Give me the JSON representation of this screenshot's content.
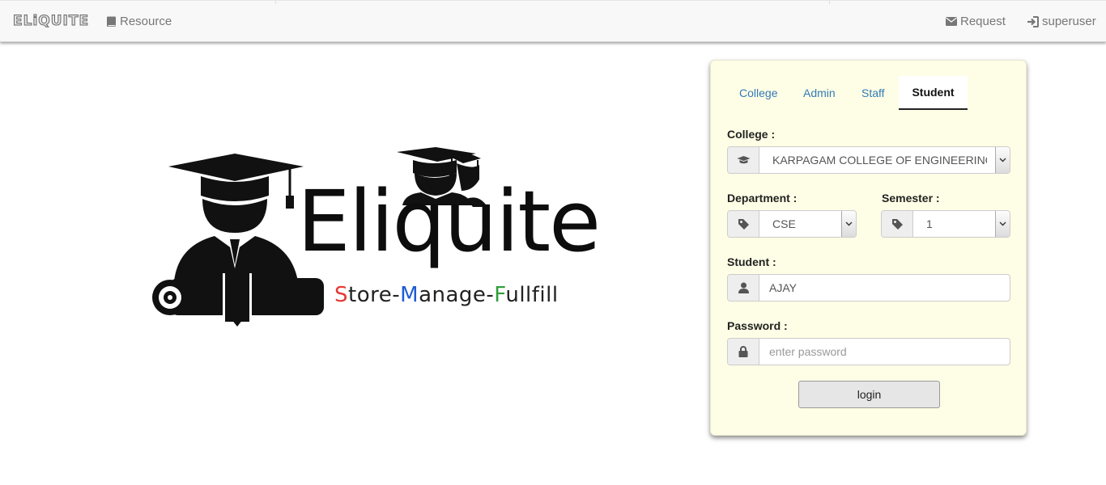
{
  "navbar": {
    "brand": "ELiQUITE",
    "resource_label": "Resource",
    "request_label": "Request",
    "user_label": "superuser"
  },
  "logo": {
    "word": "Eliquite",
    "tagline": {
      "s": "S",
      "tore": "tore-",
      "m": "M",
      "anage": "anage-",
      "f": "F",
      "ullfill": "ullfill"
    }
  },
  "login": {
    "tabs": [
      "College",
      "Admin",
      "Staff",
      "Student"
    ],
    "active_tab": "Student",
    "college_label": "College :",
    "college_value": "KARPAGAM COLLEGE OF ENGINEERING",
    "department_label": "Department :",
    "department_value": "CSE",
    "semester_label": "Semester :",
    "semester_value": "1",
    "student_label": "Student :",
    "student_value": "AJAY",
    "password_label": "Password :",
    "password_placeholder": "enter password",
    "login_button": "login"
  },
  "colors": {
    "card_bg": "#fefee6",
    "link": "#337ab7",
    "tag_s": "#e53935",
    "tag_m": "#1e5bd6",
    "tag_f": "#2e9e3a"
  }
}
